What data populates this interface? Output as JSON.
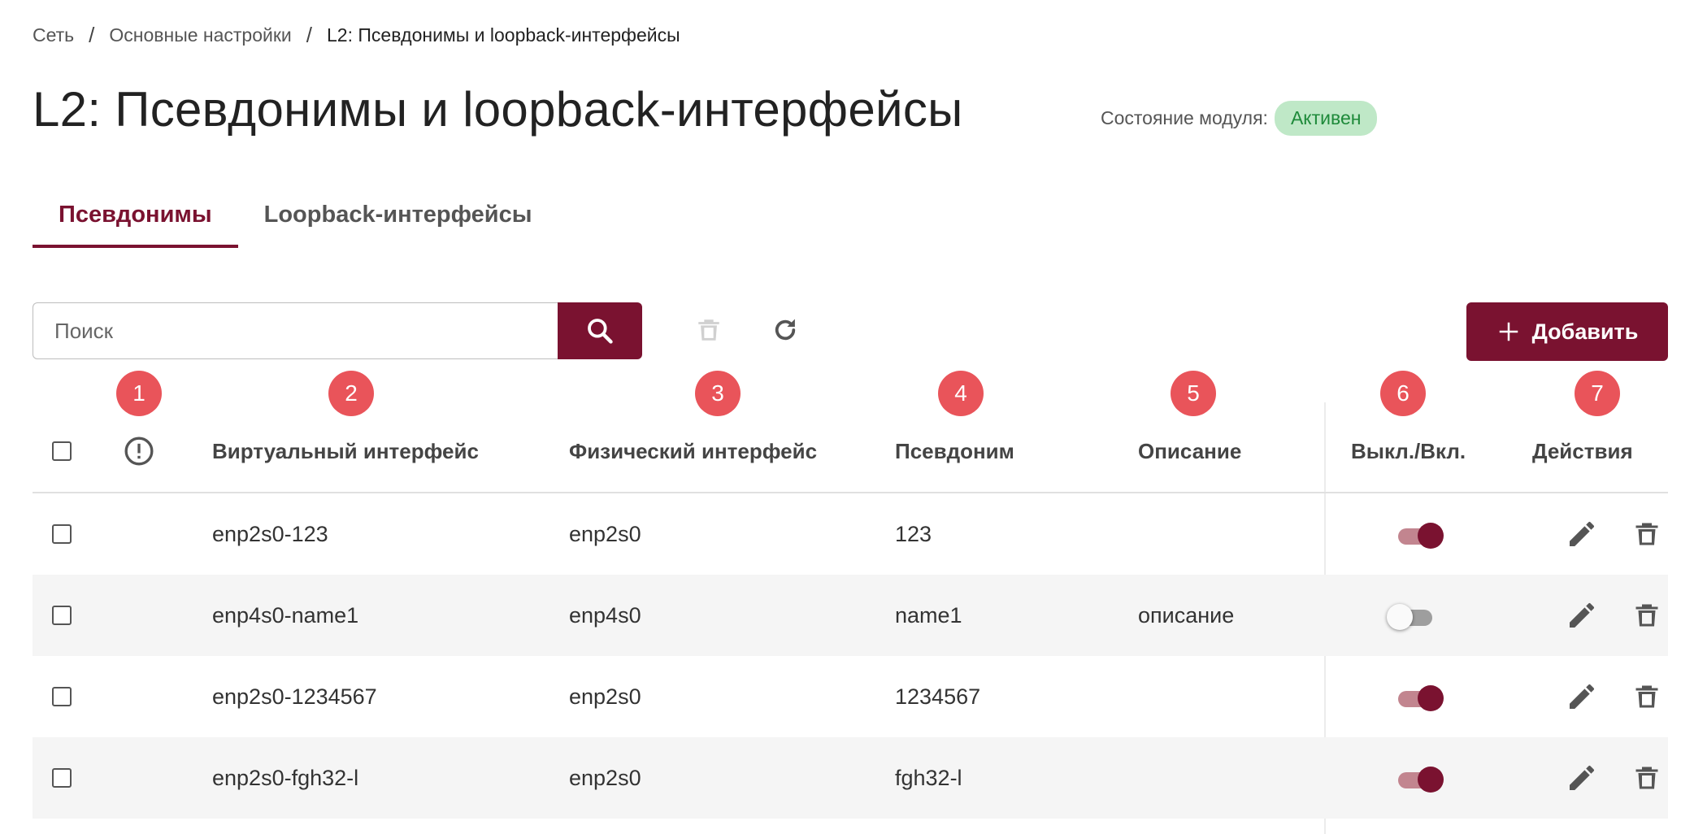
{
  "breadcrumb": {
    "items": [
      "Сеть",
      "Основные настройки",
      "L2: Псевдонимы и loopback-интерфейсы"
    ],
    "separator": "/"
  },
  "page": {
    "title": "L2: Псевдонимы и loopback-интерфейсы",
    "status_label": "Состояние модуля:",
    "status_value": "Активен"
  },
  "tabs": [
    {
      "label": "Псевдонимы",
      "active": true
    },
    {
      "label": "Loopback-интерфейсы",
      "active": false
    }
  ],
  "toolbar": {
    "search_placeholder": "Поиск",
    "search_value": "",
    "add_label": "Добавить",
    "icons": [
      "search-icon",
      "trash-icon",
      "refresh-icon",
      "plus-icon"
    ]
  },
  "markers": [
    "1",
    "2",
    "3",
    "4",
    "5",
    "6",
    "7"
  ],
  "table": {
    "columns": {
      "virtual": "Виртуальный интерфейс",
      "physical": "Физический интерфейс",
      "alias": "Псевдоним",
      "description": "Описание",
      "toggle": "Выкл./Вкл.",
      "actions": "Действия"
    },
    "rows": [
      {
        "virtual": "enp2s0-123",
        "physical": "enp2s0",
        "alias": "123",
        "description": "",
        "enabled": true
      },
      {
        "virtual": "enp4s0-name1",
        "physical": "enp4s0",
        "alias": "name1",
        "description": "описание",
        "enabled": false
      },
      {
        "virtual": "enp2s0-1234567",
        "physical": "enp2s0",
        "alias": "1234567",
        "description": "",
        "enabled": true
      },
      {
        "virtual": "enp2s0-fgh32-l",
        "physical": "enp2s0",
        "alias": "fgh32-l",
        "description": "",
        "enabled": true
      }
    ]
  },
  "colors": {
    "accent": "#7a1230",
    "marker": "#e9545a",
    "status_bg": "#bfe8c7",
    "status_text": "#1e8a3a",
    "toggle_track_on": "#c2858f",
    "row_alt": "#f5f5f5"
  }
}
